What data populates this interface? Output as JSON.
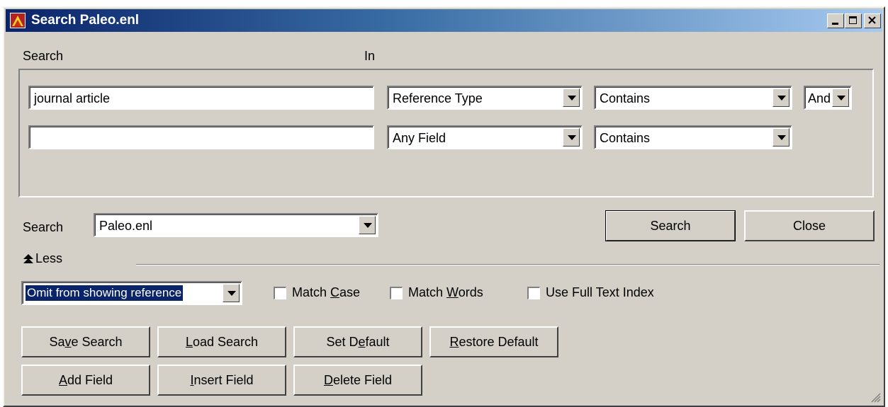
{
  "window": {
    "title": "Search Paleo.enl",
    "minimize_icon": "minimize-icon",
    "maximize_icon": "maximize-icon",
    "close_icon": "close-icon"
  },
  "headers": {
    "search": "Search",
    "in": "In"
  },
  "rows": [
    {
      "term": "journal article",
      "field": "Reference Type",
      "operator": "Contains",
      "boolean": "And"
    },
    {
      "term": "",
      "field": "Any Field",
      "operator": "Contains"
    }
  ],
  "scope": {
    "label": "Search",
    "value": "Paleo.enl"
  },
  "actions": {
    "search": "Search",
    "close": "Close"
  },
  "less": {
    "label": "Less",
    "icon": "double-up-arrow-icon"
  },
  "mode": {
    "value": "Omit from showing reference"
  },
  "options": [
    {
      "pre": "Match ",
      "key": "C",
      "post": "ase",
      "checked": false
    },
    {
      "pre": "Match ",
      "key": "W",
      "post": "ords",
      "checked": false
    },
    {
      "pre": "Use Full Text Index",
      "key": "",
      "post": "",
      "checked": false
    }
  ],
  "buttons": {
    "save_search": {
      "pre": "Sa",
      "key": "v",
      "post": "e Search"
    },
    "load_search": {
      "pre": "",
      "key": "L",
      "post": "oad Search"
    },
    "set_default": {
      "pre": "Set D",
      "key": "e",
      "post": "fault"
    },
    "restore_default": {
      "pre": "",
      "key": "R",
      "post": "estore Default"
    },
    "add_field": {
      "pre": "",
      "key": "A",
      "post": "dd Field"
    },
    "insert_field": {
      "pre": "",
      "key": "I",
      "post": "nsert Field"
    },
    "delete_field": {
      "pre": "",
      "key": "D",
      "post": "elete Field"
    }
  },
  "colors": {
    "face": "#d4d0c8",
    "title_start": "#0a246a",
    "title_end": "#a6caf0",
    "selection": "#0a246a"
  }
}
